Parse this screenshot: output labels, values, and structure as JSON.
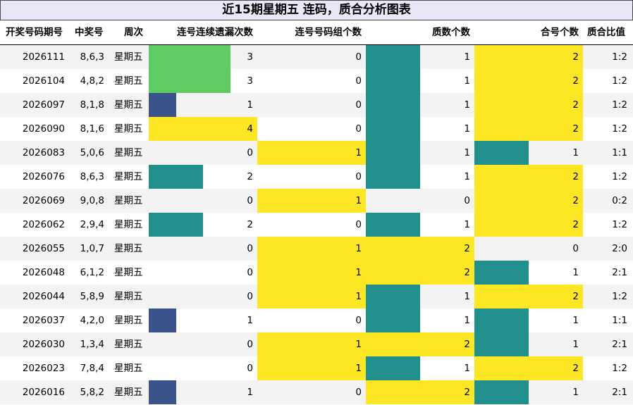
{
  "title": "近15期星期五 连码，质合分析图表",
  "headers": [
    "开奖号码期号",
    "中奖号",
    "周次",
    "连号连续遗漏次数",
    "连号号码组个数",
    "质数个数",
    "合号个数",
    "质合比值"
  ],
  "colors": {
    "green": "#5ecb63",
    "navy": "#3b538b",
    "teal": "#21908d",
    "yellow": "#fde725"
  },
  "rows": [
    {
      "issue": "2026111",
      "numbers": "8,6,3",
      "weekday": "星期五",
      "miss": "3",
      "groups": "0",
      "primes": "1",
      "composites": "2",
      "ratio": "1:2"
    },
    {
      "issue": "2026104",
      "numbers": "4,8,2",
      "weekday": "星期五",
      "miss": "3",
      "groups": "0",
      "primes": "1",
      "composites": "2",
      "ratio": "1:2"
    },
    {
      "issue": "2026097",
      "numbers": "8,1,8",
      "weekday": "星期五",
      "miss": "1",
      "groups": "0",
      "primes": "1",
      "composites": "2",
      "ratio": "1:2"
    },
    {
      "issue": "2026090",
      "numbers": "8,1,6",
      "weekday": "星期五",
      "miss": "4",
      "groups": "0",
      "primes": "1",
      "composites": "2",
      "ratio": "1:2"
    },
    {
      "issue": "2026083",
      "numbers": "5,0,6",
      "weekday": "星期五",
      "miss": "0",
      "groups": "1",
      "primes": "1",
      "composites": "1",
      "ratio": "1:1"
    },
    {
      "issue": "2026076",
      "numbers": "8,6,3",
      "weekday": "星期五",
      "miss": "2",
      "groups": "0",
      "primes": "1",
      "composites": "2",
      "ratio": "1:2"
    },
    {
      "issue": "2026069",
      "numbers": "9,0,8",
      "weekday": "星期五",
      "miss": "0",
      "groups": "1",
      "primes": "0",
      "composites": "2",
      "ratio": "0:2"
    },
    {
      "issue": "2026062",
      "numbers": "2,9,4",
      "weekday": "星期五",
      "miss": "2",
      "groups": "0",
      "primes": "1",
      "composites": "2",
      "ratio": "1:2"
    },
    {
      "issue": "2026055",
      "numbers": "1,0,7",
      "weekday": "星期五",
      "miss": "0",
      "groups": "1",
      "primes": "2",
      "composites": "0",
      "ratio": "2:0"
    },
    {
      "issue": "2026048",
      "numbers": "6,1,2",
      "weekday": "星期五",
      "miss": "0",
      "groups": "1",
      "primes": "2",
      "composites": "1",
      "ratio": "2:1"
    },
    {
      "issue": "2026044",
      "numbers": "5,8,9",
      "weekday": "星期五",
      "miss": "0",
      "groups": "1",
      "primes": "1",
      "composites": "2",
      "ratio": "1:2"
    },
    {
      "issue": "2026037",
      "numbers": "4,2,0",
      "weekday": "星期五",
      "miss": "1",
      "groups": "0",
      "primes": "1",
      "composites": "1",
      "ratio": "1:1"
    },
    {
      "issue": "2026030",
      "numbers": "1,3,4",
      "weekday": "星期五",
      "miss": "0",
      "groups": "1",
      "primes": "2",
      "composites": "1",
      "ratio": "2:1"
    },
    {
      "issue": "2026023",
      "numbers": "7,8,4",
      "weekday": "星期五",
      "miss": "0",
      "groups": "1",
      "primes": "1",
      "composites": "2",
      "ratio": "1:2"
    },
    {
      "issue": "2026016",
      "numbers": "5,8,2",
      "weekday": "星期五",
      "miss": "1",
      "groups": "0",
      "primes": "2",
      "composites": "1",
      "ratio": "2:1"
    }
  ]
}
